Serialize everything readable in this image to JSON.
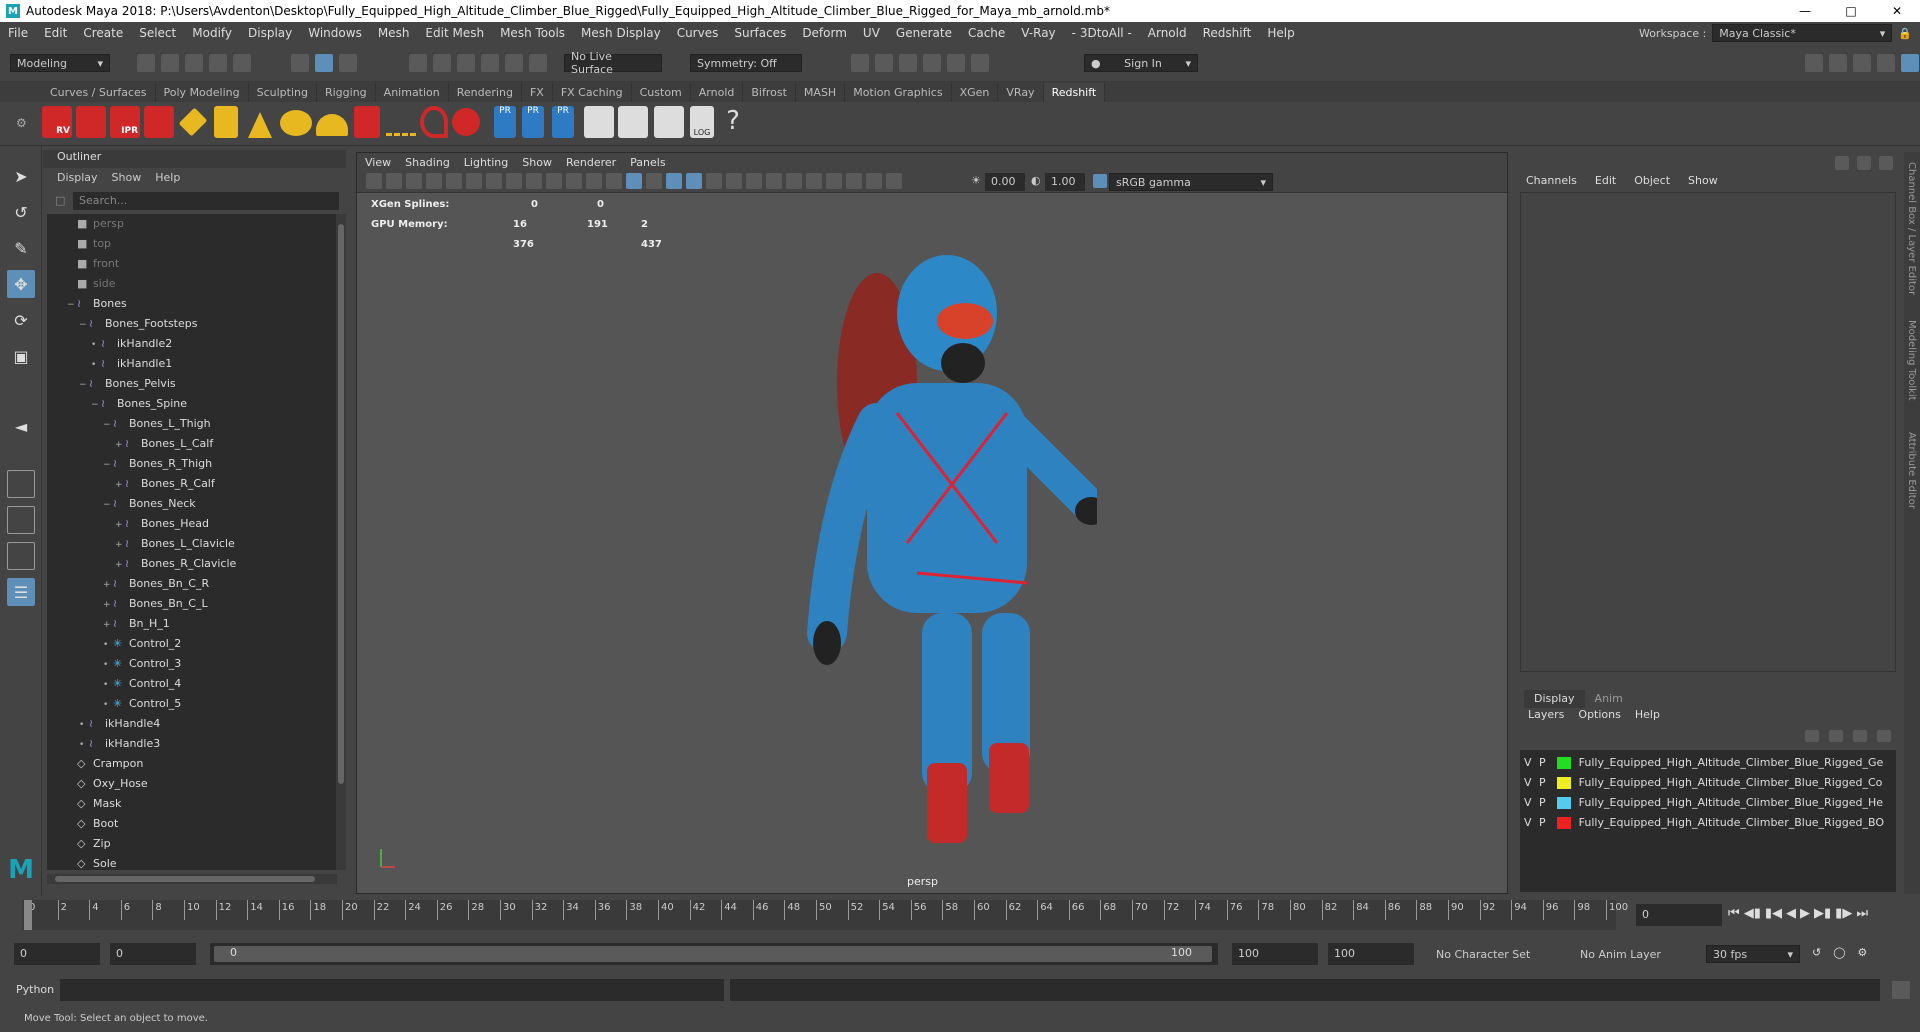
{
  "window": {
    "title": "Autodesk Maya 2018: P:\\Users\\Avdenton\\Desktop\\Fully_Equipped_High_Altitude_Climber_Blue_Rigged\\Fully_Equipped_High_Altitude_Climber_Blue_Rigged_for_Maya_mb_arnold.mb*"
  },
  "menus": [
    "File",
    "Edit",
    "Create",
    "Select",
    "Modify",
    "Display",
    "Windows",
    "Mesh",
    "Edit Mesh",
    "Mesh Tools",
    "Mesh Display",
    "Curves",
    "Surfaces",
    "Deform",
    "UV",
    "Generate",
    "Cache",
    "V-Ray",
    "- 3DtoAll -",
    "Arnold",
    "Redshift",
    "Help"
  ],
  "workspace": {
    "label": "Workspace :",
    "value": "Maya Classic*"
  },
  "status": {
    "mode": "Modeling",
    "live_surface": "No Live Surface",
    "symmetry": "Symmetry: Off",
    "sign_in": "Sign In"
  },
  "shelf_tabs": [
    "Curves / Surfaces",
    "Poly Modeling",
    "Sculpting",
    "Rigging",
    "Animation",
    "Rendering",
    "FX",
    "FX Caching",
    "Custom",
    "Arnold",
    "Bifrost",
    "MASH",
    "Motion Graphics",
    "XGen",
    "VRay",
    "Redshift"
  ],
  "shelf_active": "Redshift",
  "shelf_labels": {
    "rv": "RV",
    "ipr": "IPR",
    "pr1": "PR",
    "pr2": "PR",
    "pr3": "PR",
    "log": "LOG"
  },
  "outliner": {
    "title": "Outliner",
    "menu": [
      "Display",
      "Show",
      "Help"
    ],
    "search_placeholder": "Search...",
    "items": [
      {
        "label": "persp",
        "depth": 0,
        "kind": "camera"
      },
      {
        "label": "top",
        "depth": 0,
        "kind": "camera"
      },
      {
        "label": "front",
        "depth": 0,
        "kind": "camera"
      },
      {
        "label": "side",
        "depth": 0,
        "kind": "camera"
      },
      {
        "label": "Bones",
        "depth": 0,
        "kind": "joint",
        "exp": "−"
      },
      {
        "label": "Bones_Footsteps",
        "depth": 1,
        "kind": "joint",
        "exp": "−"
      },
      {
        "label": "ikHandle2",
        "depth": 2,
        "kind": "ik",
        "exp": "•"
      },
      {
        "label": "ikHandle1",
        "depth": 2,
        "kind": "ik",
        "exp": "•"
      },
      {
        "label": "Bones_Pelvis",
        "depth": 1,
        "kind": "joint",
        "exp": "−"
      },
      {
        "label": "Bones_Spine",
        "depth": 2,
        "kind": "joint",
        "exp": "−"
      },
      {
        "label": "Bones_L_Thigh",
        "depth": 3,
        "kind": "joint",
        "exp": "−"
      },
      {
        "label": "Bones_L_Calf",
        "depth": 4,
        "kind": "joint",
        "exp": "+"
      },
      {
        "label": "Bones_R_Thigh",
        "depth": 3,
        "kind": "joint",
        "exp": "−"
      },
      {
        "label": "Bones_R_Calf",
        "depth": 4,
        "kind": "joint",
        "exp": "+"
      },
      {
        "label": "Bones_Neck",
        "depth": 3,
        "kind": "joint",
        "exp": "−"
      },
      {
        "label": "Bones_Head",
        "depth": 4,
        "kind": "joint",
        "exp": "+"
      },
      {
        "label": "Bones_L_Clavicle",
        "depth": 4,
        "kind": "joint",
        "exp": "+"
      },
      {
        "label": "Bones_R_Clavicle",
        "depth": 4,
        "kind": "joint",
        "exp": "+"
      },
      {
        "label": "Bones_Bn_C_R",
        "depth": 3,
        "kind": "joint",
        "exp": "+"
      },
      {
        "label": "Bones_Bn_C_L",
        "depth": 3,
        "kind": "joint",
        "exp": "+"
      },
      {
        "label": "Bn_H_1",
        "depth": 3,
        "kind": "joint",
        "exp": "+"
      },
      {
        "label": "Control_2",
        "depth": 3,
        "kind": "control",
        "exp": "•"
      },
      {
        "label": "Control_3",
        "depth": 3,
        "kind": "control",
        "exp": "•"
      },
      {
        "label": "Control_4",
        "depth": 3,
        "kind": "control",
        "exp": "•"
      },
      {
        "label": "Control_5",
        "depth": 3,
        "kind": "control",
        "exp": "•"
      },
      {
        "label": "ikHandle4",
        "depth": 1,
        "kind": "ik",
        "exp": "•"
      },
      {
        "label": "ikHandle3",
        "depth": 1,
        "kind": "ik",
        "exp": "•"
      },
      {
        "label": "Crampon",
        "depth": 0,
        "kind": "mesh"
      },
      {
        "label": "Oxy_Hose",
        "depth": 0,
        "kind": "mesh"
      },
      {
        "label": "Mask",
        "depth": 0,
        "kind": "mesh"
      },
      {
        "label": "Boot",
        "depth": 0,
        "kind": "mesh"
      },
      {
        "label": "Zip",
        "depth": 0,
        "kind": "mesh"
      },
      {
        "label": "Sole",
        "depth": 0,
        "kind": "mesh"
      }
    ]
  },
  "viewport": {
    "menu": [
      "View",
      "Shading",
      "Lighting",
      "Show",
      "Renderer",
      "Panels"
    ],
    "exposure": "0.00",
    "gamma": "1.00",
    "color_space": "sRGB gamma",
    "hud": [
      {
        "label": "XGen Splines:",
        "v1": "0",
        "v2": "0",
        "v3": ""
      },
      {
        "label": "GPU Memory:",
        "v1": "16 376",
        "v2": "191",
        "v3": "2 437"
      }
    ],
    "camera": "persp"
  },
  "channel_box": {
    "menu": [
      "Channels",
      "Edit",
      "Object",
      "Show"
    ]
  },
  "layer_editor": {
    "tabs": [
      "Display",
      "Anim"
    ],
    "menu": [
      "Layers",
      "Options",
      "Help"
    ],
    "layers": [
      {
        "v": "V",
        "p": "P",
        "color": "#22dd22",
        "name": "Fully_Equipped_High_Altitude_Climber_Blue_Rigged_Ge"
      },
      {
        "v": "V",
        "p": "P",
        "color": "#eeee22",
        "name": "Fully_Equipped_High_Altitude_Climber_Blue_Rigged_Co"
      },
      {
        "v": "V",
        "p": "P",
        "color": "#55ccee",
        "name": "Fully_Equipped_High_Altitude_Climber_Blue_Rigged_He"
      },
      {
        "v": "V",
        "p": "P",
        "color": "#ee2222",
        "name": "Fully_Equipped_High_Altitude_Climber_Blue_Rigged_BO"
      }
    ]
  },
  "side_tabs": [
    "Channel Box / Layer Editor",
    "Modeling Toolkit",
    "Attribute Editor"
  ],
  "timeline": {
    "ticks": [
      "0",
      "2",
      "4",
      "6",
      "8",
      "10",
      "12",
      "14",
      "16",
      "18",
      "20",
      "22",
      "24",
      "26",
      "28",
      "30",
      "32",
      "34",
      "36",
      "38",
      "40",
      "42",
      "44",
      "46",
      "48",
      "50",
      "52",
      "54",
      "56",
      "58",
      "60",
      "62",
      "64",
      "66",
      "68",
      "70",
      "72",
      "74",
      "76",
      "78",
      "80",
      "82",
      "84",
      "86",
      "88",
      "90",
      "92",
      "94",
      "96",
      "98",
      "100"
    ],
    "current_frame": "0"
  },
  "range": {
    "start": "0",
    "start2": "0",
    "slider_start": "0",
    "slider_end": "100",
    "end": "100",
    "end2": "100",
    "character_set": "No Character Set",
    "anim_layer": "No Anim Layer",
    "fps": "30 fps"
  },
  "command_line": {
    "lang": "Python"
  },
  "help_line": "Move Tool: Select an object to move."
}
